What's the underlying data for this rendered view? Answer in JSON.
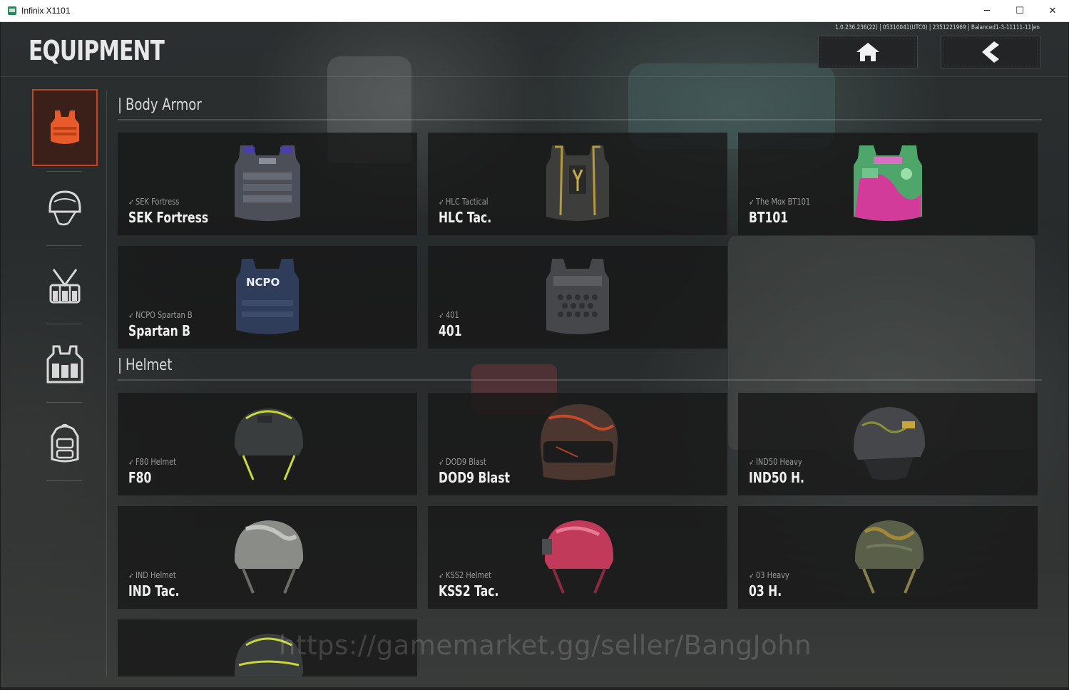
{
  "window": {
    "title": "Infinix X1101",
    "minimize": "─",
    "maximize": "☐",
    "close": "✕"
  },
  "header": {
    "title": "EQUIPMENT",
    "build_info": "1.0.236.236(22) | 05310041(UTC0) | 2351221969 | Balanced1-3-11111-11|en",
    "home_icon": "home-icon",
    "back_icon": "back-arrow-icon"
  },
  "sidebar": {
    "tabs": [
      {
        "icon": "body-armor-icon",
        "active": true
      },
      {
        "icon": "helmet-icon",
        "active": false
      },
      {
        "icon": "chest-rig-icon",
        "active": false
      },
      {
        "icon": "tactical-vest-icon",
        "active": false
      },
      {
        "icon": "backpack-icon",
        "active": false
      }
    ],
    "accent_color": "#c4421e"
  },
  "sections": {
    "body_armor": {
      "title": "Body Armor",
      "items": [
        {
          "subtitle": "SEK Fortress",
          "name": "SEK Fortress",
          "art": "armor-sek-icon"
        },
        {
          "subtitle": "HLC Tactical",
          "name": "HLC Tac.",
          "art": "armor-hlc-icon"
        },
        {
          "subtitle": "The Mox BT101",
          "name": "BT101",
          "art": "armor-bt101-icon"
        },
        {
          "subtitle": "NCPO Spartan B",
          "name": "Spartan B",
          "art": "armor-ncpo-icon"
        },
        {
          "subtitle": "401",
          "name": "401",
          "art": "armor-401-icon"
        }
      ]
    },
    "helmet": {
      "title": "Helmet",
      "items": [
        {
          "subtitle": "F80 Helmet",
          "name": "F80",
          "art": "helmet-f80-icon"
        },
        {
          "subtitle": "DOD9 Blast",
          "name": "DOD9 Blast",
          "art": "helmet-dod9-icon"
        },
        {
          "subtitle": "IND50 Heavy",
          "name": "IND50 H.",
          "art": "helmet-ind50-icon"
        },
        {
          "subtitle": "IND Helmet",
          "name": "IND Tac.",
          "art": "helmet-ind-icon"
        },
        {
          "subtitle": "KSS2 Helmet",
          "name": "KSS2 Tac.",
          "art": "helmet-kss2-icon"
        },
        {
          "subtitle": "03 Heavy",
          "name": "03 H.",
          "art": "helmet-03-icon"
        },
        {
          "subtitle": "",
          "name": "",
          "art": "helmet-partial-icon"
        }
      ]
    }
  },
  "watermark": "https://gamemarket.gg/seller/BangJohn"
}
